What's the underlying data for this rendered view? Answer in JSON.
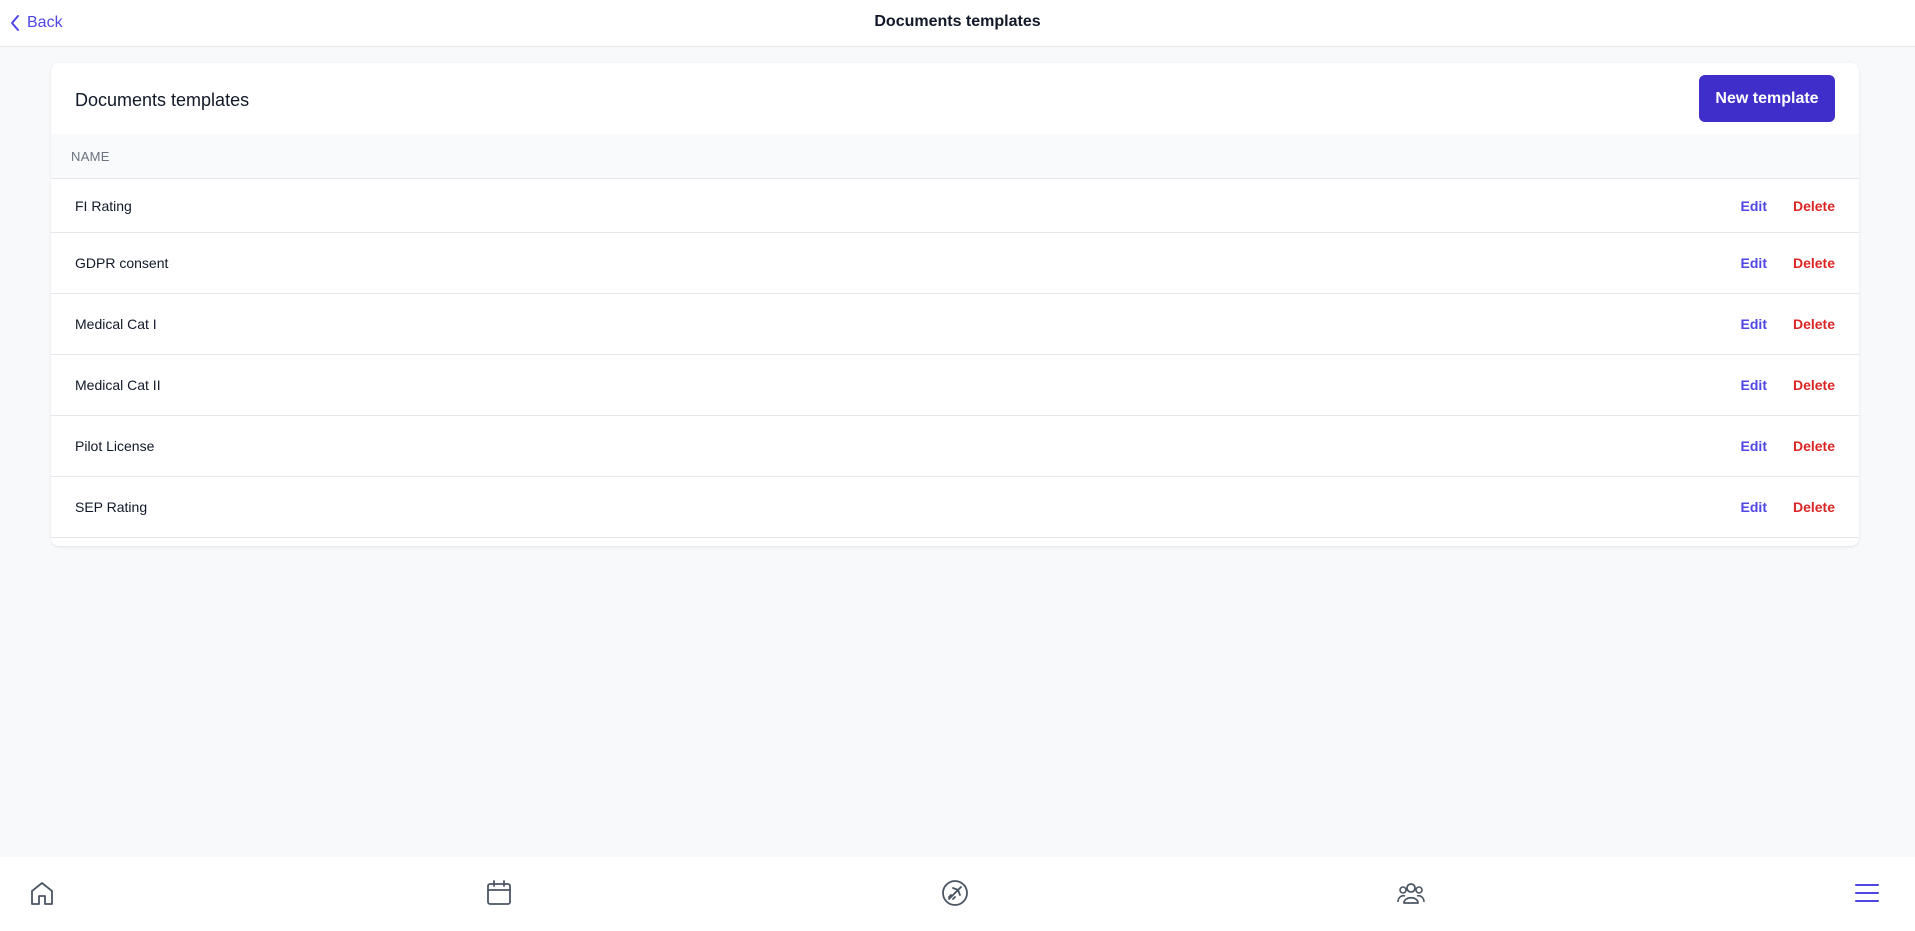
{
  "header": {
    "back_label": "Back",
    "title": "Documents templates"
  },
  "card": {
    "title": "Documents templates",
    "new_button_label": "New template",
    "column_header": "NAME",
    "rows": [
      {
        "name": "FI Rating",
        "edit": "Edit",
        "delete": "Delete"
      },
      {
        "name": "GDPR consent",
        "edit": "Edit",
        "delete": "Delete"
      },
      {
        "name": "Medical Cat I",
        "edit": "Edit",
        "delete": "Delete"
      },
      {
        "name": "Medical Cat II",
        "edit": "Edit",
        "delete": "Delete"
      },
      {
        "name": "Pilot License",
        "edit": "Edit",
        "delete": "Delete"
      },
      {
        "name": "SEP Rating",
        "edit": "Edit",
        "delete": "Delete"
      }
    ]
  },
  "bottom_nav": {
    "items": [
      "home-icon",
      "calendar-icon",
      "flight-icon",
      "people-icon",
      "menu-icon"
    ]
  },
  "colors": {
    "accent": "#4f46e5",
    "primary_button": "#3f2ec9",
    "danger": "#dc2626"
  }
}
